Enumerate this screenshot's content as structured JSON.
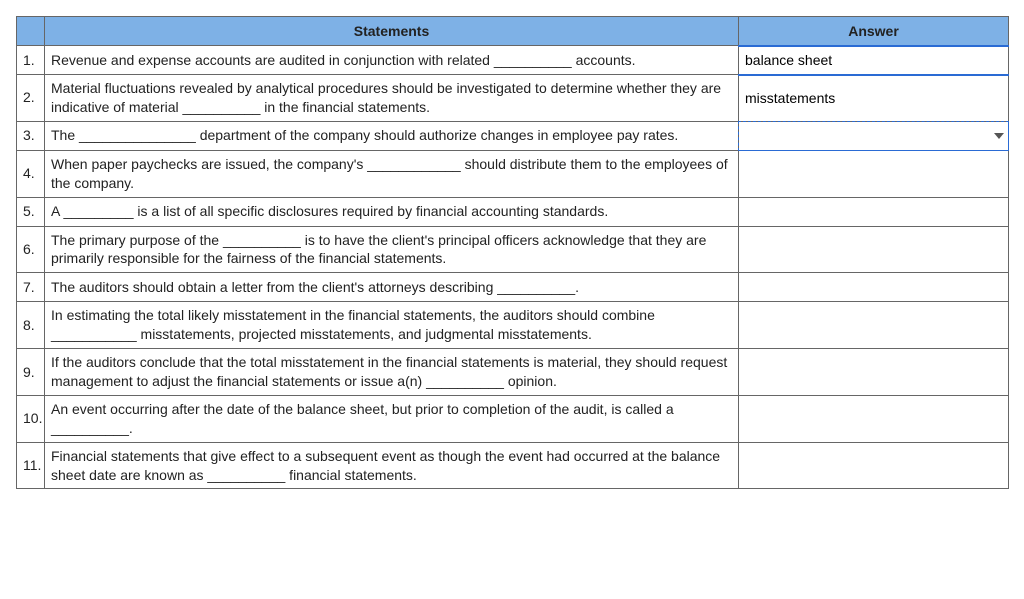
{
  "headers": {
    "statements": "Statements",
    "answer": "Answer"
  },
  "rows": [
    {
      "num": "1.",
      "statement": "Revenue and expense accounts are audited in conjunction with related __________ accounts.",
      "answer": "balance sheet",
      "filled": true
    },
    {
      "num": "2.",
      "statement": "Material fluctuations revealed by analytical procedures should be investigated to determine whether they are indicative of material __________ in the financial statements.",
      "answer": "misstatements",
      "filled": true
    },
    {
      "num": "3.",
      "statement": "The _______________ department of the company should authorize changes in employee pay rates.",
      "answer": "",
      "active": true
    },
    {
      "num": "4.",
      "statement": "When paper paychecks are issued, the company's ____________ should distribute them to the employees of the company.",
      "answer": ""
    },
    {
      "num": "5.",
      "statement": "A _________ is a list of all specific disclosures required by financial accounting standards.",
      "answer": ""
    },
    {
      "num": "6.",
      "statement": "The primary purpose of the __________ is to have the client's principal officers acknowledge that they are primarily responsible for the fairness of the financial statements.",
      "answer": ""
    },
    {
      "num": "7.",
      "statement": "The auditors should obtain a letter from the client's attorneys describing __________.",
      "answer": ""
    },
    {
      "num": "8.",
      "statement": "In estimating the total likely misstatement in the financial statements, the auditors should combine ___________ misstatements, projected misstatements, and judgmental misstatements.",
      "answer": ""
    },
    {
      "num": "9.",
      "statement": "If the auditors conclude that the total misstatement in the financial statements is material, they should request management to adjust the financial statements or issue a(n) __________ opinion.",
      "answer": ""
    },
    {
      "num": "10.",
      "statement": "An event occurring after the date of the balance sheet, but prior to completion of the audit, is called a __________.",
      "answer": ""
    },
    {
      "num": "11.",
      "statement": "Financial statements that give effect to a subsequent event as though the event had occurred at the balance sheet date are known as __________ financial statements.",
      "answer": ""
    }
  ]
}
